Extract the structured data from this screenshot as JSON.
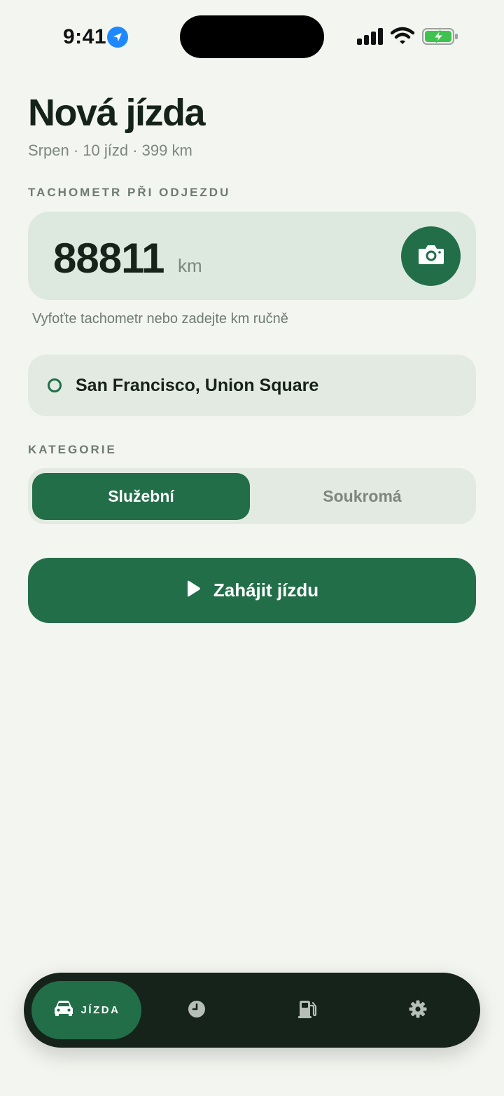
{
  "status_bar": {
    "time": "9:41"
  },
  "header": {
    "title": "Nová jízda",
    "subtitle": "Srpen · 10 jízd · 399 km"
  },
  "odometer": {
    "section_label": "TACHOMETR PŘI ODJEZDU",
    "value": "88811",
    "unit": "km",
    "hint": "Vyfoťte tachometr nebo zadejte km ručně",
    "camera_icon": "camera-icon"
  },
  "location": {
    "value": "San Francisco, Union Square"
  },
  "category": {
    "section_label": "KATEGORIE",
    "options": [
      "Služební",
      "Soukromá"
    ],
    "selected": "Služební"
  },
  "start_button": {
    "label": "Zahájit jízdu",
    "icon": "play-icon"
  },
  "bottom_nav": {
    "items": [
      {
        "label": "JÍZDA",
        "icon": "car-icon",
        "active": true
      },
      {
        "label": "",
        "icon": "clock-icon",
        "active": false
      },
      {
        "label": "",
        "icon": "fuel-icon",
        "active": false
      },
      {
        "label": "",
        "icon": "gear-icon",
        "active": false
      }
    ]
  },
  "colors": {
    "accent": "#226e49",
    "background": "#f3f5f0",
    "nav_background": "#16231a",
    "card": "#dde9df"
  }
}
